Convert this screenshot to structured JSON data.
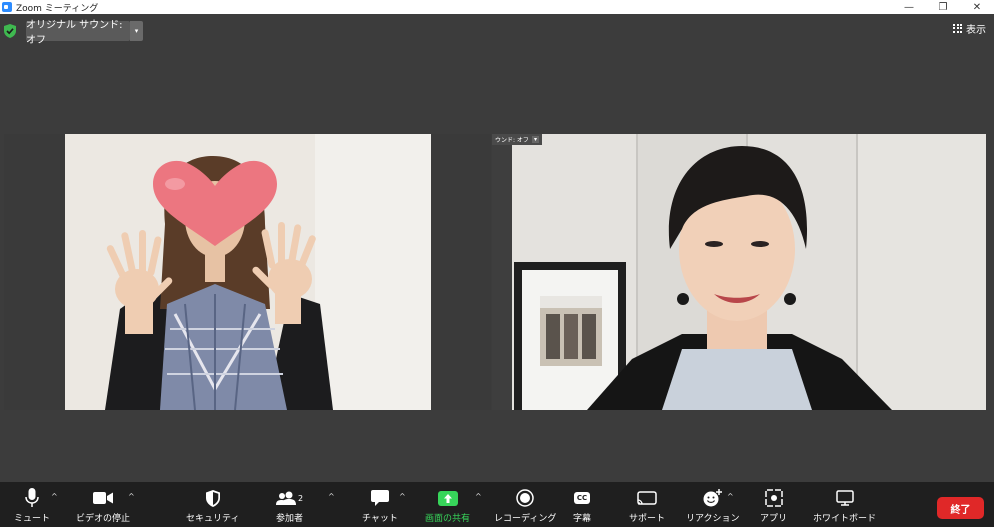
{
  "window": {
    "title": "Zoom ミーティング",
    "minimize": "—",
    "restore": "❐",
    "close": "✕"
  },
  "topbar": {
    "audio_label": "オリジナル サウンド: オフ",
    "audio_caret": "▾",
    "view_label": "表示"
  },
  "tiles": {
    "right_label": "ウンド: オフ",
    "right_caret": "▾"
  },
  "toolbar": {
    "mute": "ミュート",
    "video": "ビデオの停止",
    "security": "セキュリティ",
    "participants": "参加者",
    "participants_count": "2",
    "chat": "チャット",
    "share": "画面の共有",
    "record": "レコーディング",
    "captions": "字幕",
    "captions_icon": "CC",
    "support": "サポート",
    "reactions": "リアクション",
    "apps": "アプリ",
    "whiteboard": "ホワイトボード",
    "caret": "^",
    "end": "終了"
  },
  "colors": {
    "share_accent": "#37d55a",
    "end_button": "#e02828",
    "shield": "#3fb950"
  }
}
